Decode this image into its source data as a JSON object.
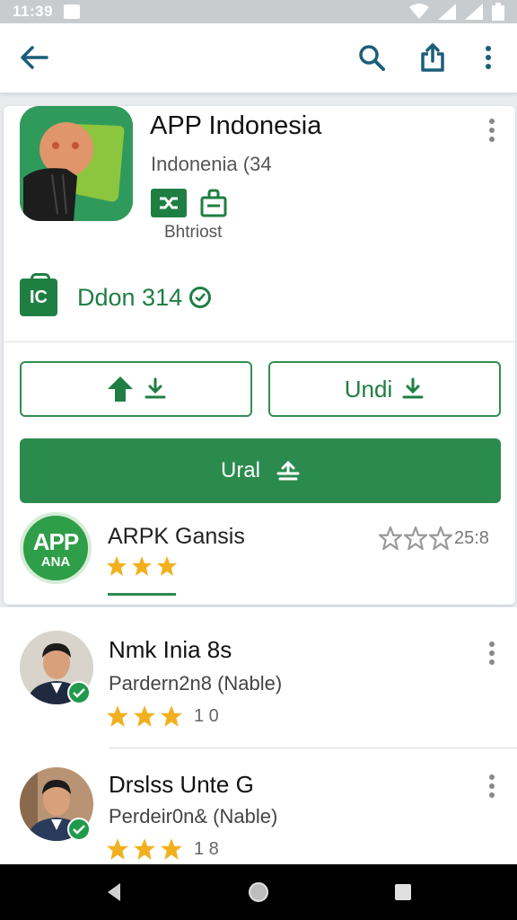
{
  "status_bar": {
    "time": "11:39"
  },
  "toolbar": {
    "back_icon": "arrow-left-icon",
    "search_icon": "search-icon",
    "share_icon": "share-icon",
    "more_icon": "more-vert-icon"
  },
  "app": {
    "title": "APP Indonesia",
    "subtitle": "Indonenia (34",
    "badge_label": "Bhtriost",
    "developer_badge": "IC",
    "developer": "Ddon 314"
  },
  "actions": {
    "undo_label": "Undi",
    "install_label": "Ural"
  },
  "related": {
    "icon_text_top": "APP",
    "icon_text_bottom": "ANA",
    "name": "ARPK Gansis",
    "stars": 3,
    "rating": "25:8"
  },
  "reviews": [
    {
      "name": "Nmk Inia 8s",
      "subtitle": "Pardern2n8 (Nable)",
      "stars": 3,
      "score": "1 0"
    },
    {
      "name": "Drslss Unte G",
      "subtitle": "Perdeir0n& (Nable)",
      "stars": 3,
      "score": "1 8"
    }
  ],
  "colors": {
    "accent": "#2b8b4e",
    "star": "#f2b01e"
  }
}
